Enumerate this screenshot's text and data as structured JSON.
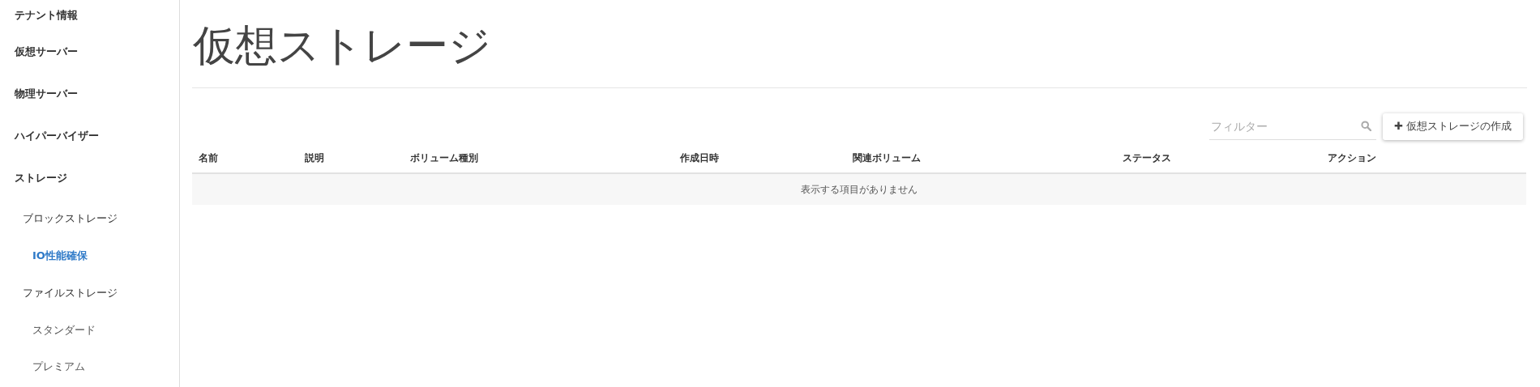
{
  "sidebar": {
    "items": [
      {
        "label": "テナント情報",
        "selected": false
      },
      {
        "label": "仮想サーバー",
        "selected": false
      },
      {
        "label": "物理サーバー",
        "selected": false
      },
      {
        "label": "ハイパーバイザー",
        "selected": false
      },
      {
        "label": "ストレージ",
        "selected": false,
        "children": [
          {
            "label": "ブロックストレージ",
            "selected": false,
            "children": [
              {
                "label": "IO性能確保",
                "selected": true
              }
            ]
          },
          {
            "label": "ファイルストレージ",
            "selected": false,
            "children": [
              {
                "label": "スタンダード",
                "selected": false
              },
              {
                "label": "プレミアム",
                "selected": false
              }
            ]
          }
        ]
      }
    ]
  },
  "page_title": "仮想ストレージ",
  "filter": {
    "placeholder": "フィルター"
  },
  "create_button": {
    "icon": "✚",
    "label": "仮想ストレージの作成"
  },
  "table": {
    "columns": [
      "名前",
      "説明",
      "ボリューム種別",
      "作成日時",
      "関連ボリューム",
      "ステータス",
      "アクション"
    ],
    "empty_message": "表示する項目がありません"
  }
}
